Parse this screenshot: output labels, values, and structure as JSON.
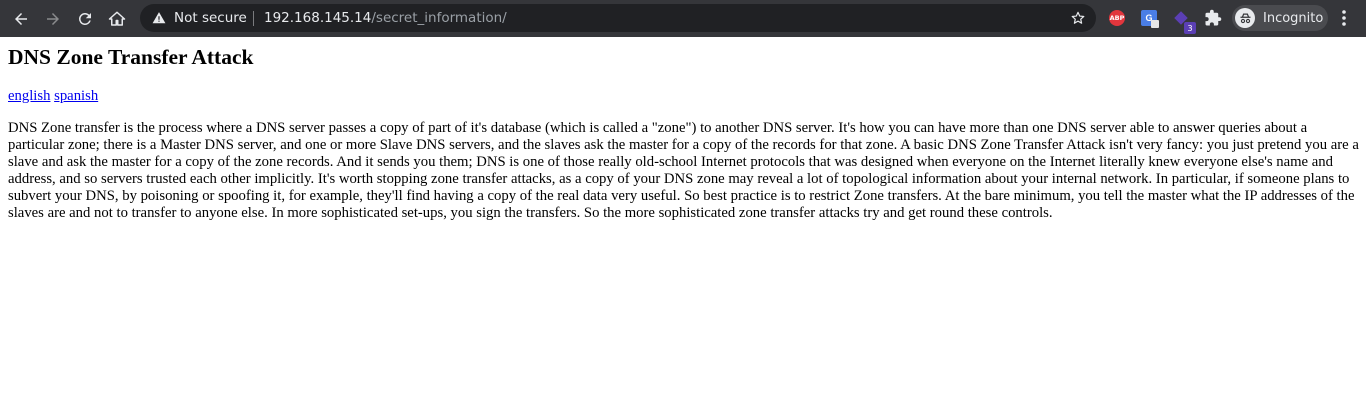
{
  "browser": {
    "security_label": "Not secure",
    "url_host": "192.168.145.14",
    "url_path": "/secret_information/",
    "extensions": {
      "abp_label": "ABP",
      "translate_label": "G",
      "badge_count": "3"
    },
    "profile_label": "Incognito"
  },
  "page": {
    "title": "DNS Zone Transfer Attack",
    "links": {
      "english": "english",
      "spanish": "spanish"
    },
    "body_text": "DNS Zone transfer is the process where a DNS server passes a copy of part of it's database (which is called a \"zone\") to another DNS server. It's how you can have more than one DNS server able to answer queries about a particular zone; there is a Master DNS server, and one or more Slave DNS servers, and the slaves ask the master for a copy of the records for that zone. A basic DNS Zone Transfer Attack isn't very fancy: you just pretend you are a slave and ask the master for a copy of the zone records. And it sends you them; DNS is one of those really old-school Internet protocols that was designed when everyone on the Internet literally knew everyone else's name and address, and so servers trusted each other implicitly. It's worth stopping zone transfer attacks, as a copy of your DNS zone may reveal a lot of topological information about your internal network. In particular, if someone plans to subvert your DNS, by poisoning or spoofing it, for example, they'll find having a copy of the real data very useful. So best practice is to restrict Zone transfers. At the bare minimum, you tell the master what the IP addresses of the slaves are and not to transfer to anyone else. In more sophisticated set-ups, you sign the transfers. So the more sophisticated zone transfer attacks try and get round these controls."
  }
}
